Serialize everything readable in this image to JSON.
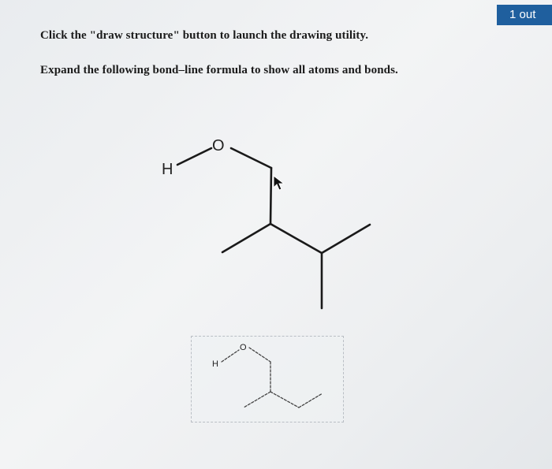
{
  "header": {
    "progress_badge": "1 out"
  },
  "question": {
    "instruction_draw": "Click the \"draw structure\" button to launch the drawing utility.",
    "instruction_expand": "Expand the following bond–line formula to show all atoms and bonds."
  },
  "structure": {
    "atom_oxygen": "O",
    "atom_hydrogen": "H"
  },
  "preview": {
    "atom_oxygen": "O",
    "atom_hydrogen": "H"
  }
}
